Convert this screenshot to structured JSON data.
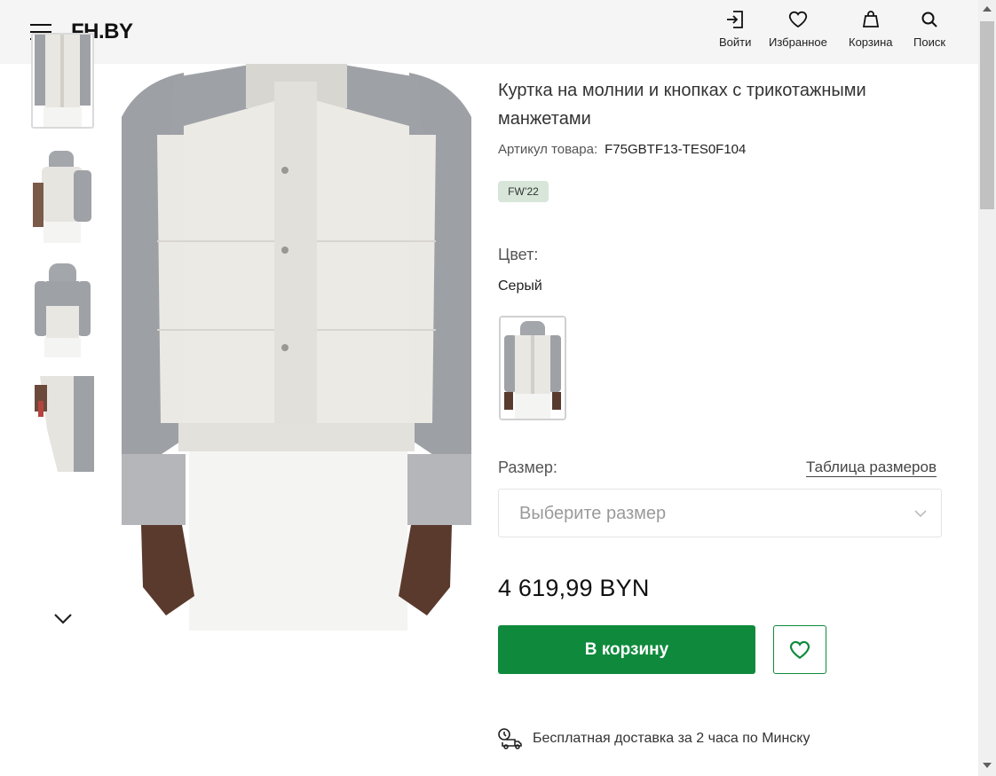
{
  "header": {
    "logo": "FH.BY",
    "nav": [
      {
        "label": "Войти",
        "icon": "login-icon"
      },
      {
        "label": "Избранное",
        "icon": "heart-icon"
      },
      {
        "label": "Корзина",
        "icon": "bag-icon"
      },
      {
        "label": "Поиск",
        "icon": "search-icon"
      }
    ]
  },
  "gallery": {
    "thumbnails": [
      "jacket-front-crop",
      "jacket-side-hood",
      "jacket-back-hood",
      "jacket-lining-detail"
    ],
    "active_index": 0,
    "main_image": "jacket-front"
  },
  "product": {
    "title": "Куртка на молнии и кнопках с трикотажными манжетами",
    "sku_label": "Артикул товара:",
    "sku": "F75GBTF13-TES0F104",
    "season": "FW’22",
    "color_label": "Цвет:",
    "color_value": "Серый",
    "size_label": "Размер:",
    "size_table_link": "Таблица размеров",
    "size_placeholder": "Выберите размер",
    "price": "4 619,99 BYN",
    "add_to_cart": "В корзину",
    "delivery": "Бесплатная доставка за 2 часа по Минску"
  },
  "colors": {
    "accent": "#0f8a3c",
    "header_bg": "#f5f5f5",
    "season_badge_bg": "#d7e6d9"
  }
}
